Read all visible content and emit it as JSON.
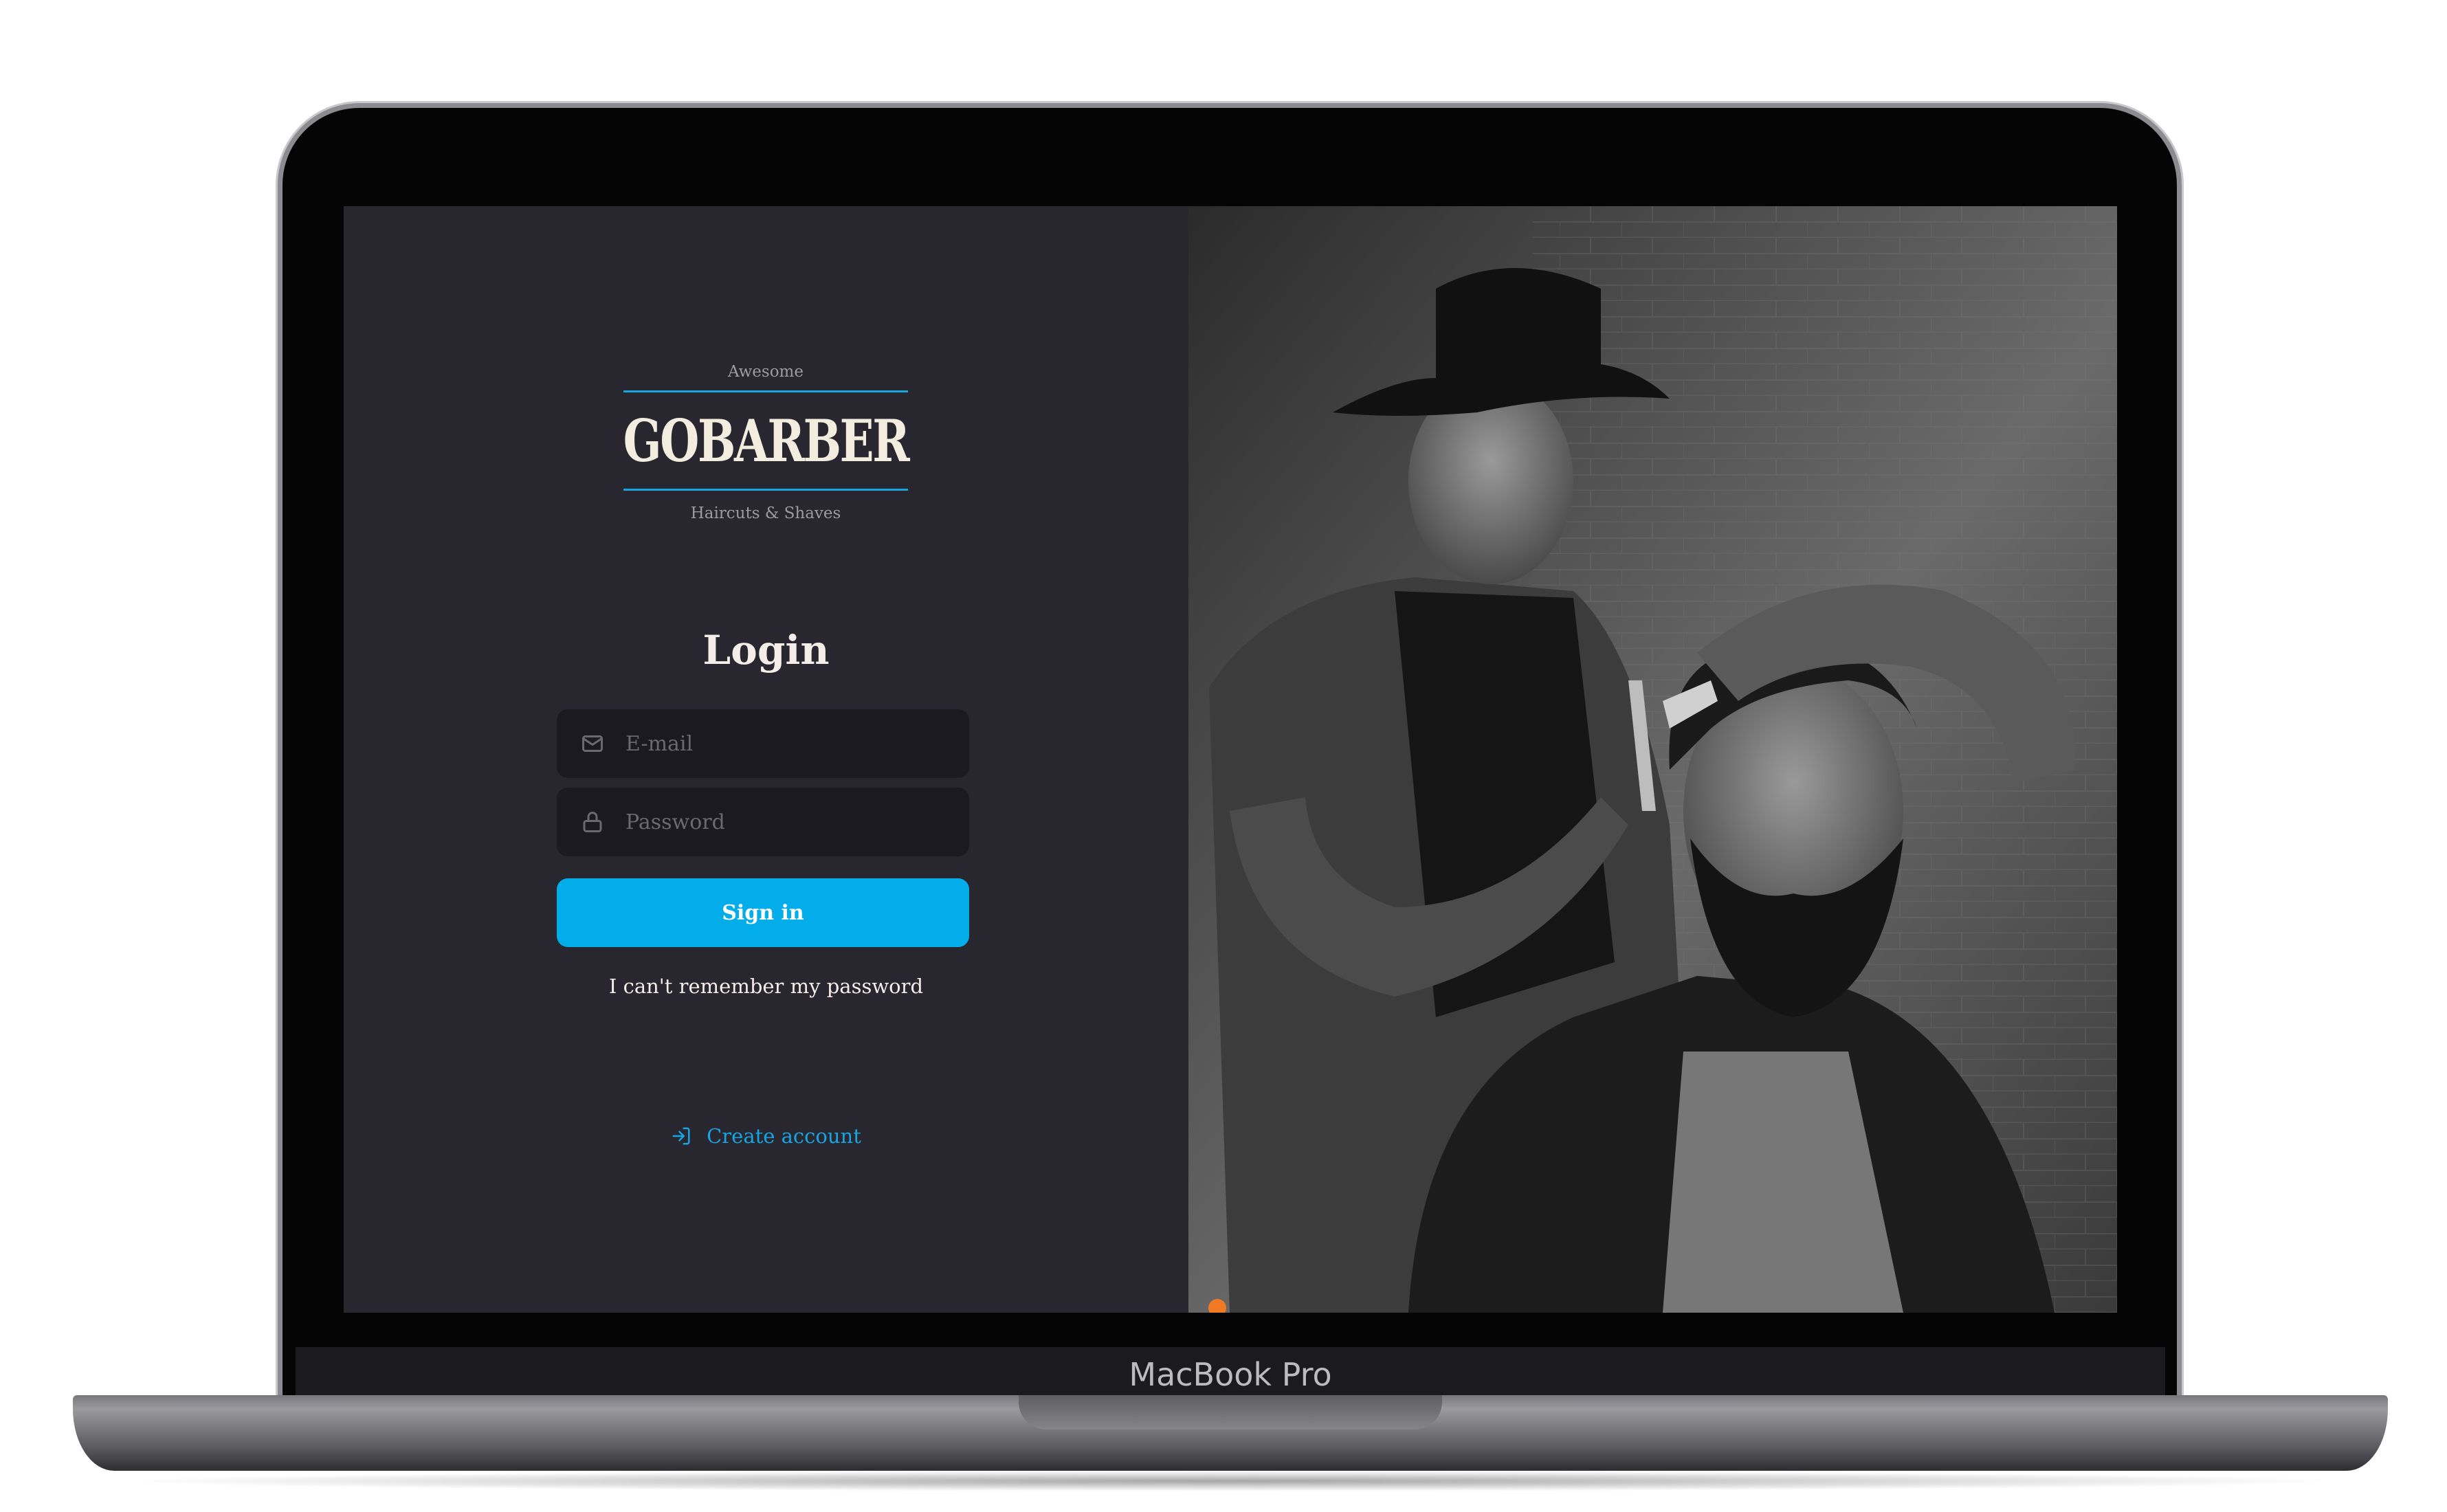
{
  "device": {
    "label": "MacBook Pro"
  },
  "logo": {
    "tagline_top": "Awesome",
    "name": "GOBARBER",
    "tagline_bottom": "Haircuts & Shaves"
  },
  "login": {
    "title": "Login",
    "email": {
      "placeholder": "E-mail",
      "icon": "mail-icon"
    },
    "password": {
      "placeholder": "Password",
      "icon": "lock-icon"
    },
    "submit_label": "Sign in",
    "forgot_label": "I can't remember my password",
    "create_label": "Create account",
    "create_icon": "log-in-icon"
  },
  "colors": {
    "background": "#28262e",
    "input_background": "#1b1a20",
    "accent": "#02adea",
    "text": "#f4ede8",
    "placeholder": "#6a6870"
  },
  "photo": {
    "description_icon": "barber-photo"
  }
}
